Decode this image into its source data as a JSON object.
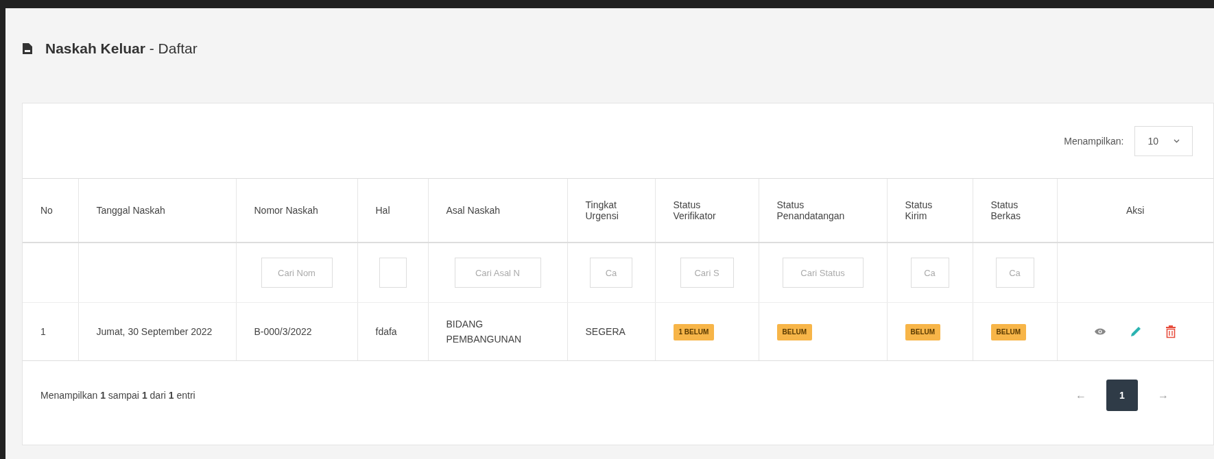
{
  "page": {
    "title_main": "Naskah Keluar",
    "title_sub": " - Daftar"
  },
  "length_menu": {
    "label": "Menampilkan:",
    "value": "10"
  },
  "table": {
    "columns": [
      "No",
      "Tanggal Naskah",
      "Nomor Naskah",
      "Hal",
      "Asal Naskah",
      "Tingkat Urgensi",
      "Status Verifikator",
      "Status Penandatangan",
      "Status Kirim",
      "Status Berkas",
      "Aksi"
    ],
    "filters": [
      {
        "kind": "none"
      },
      {
        "kind": "none"
      },
      {
        "kind": "text",
        "placeholder": "Cari Nom"
      },
      {
        "kind": "text"
      },
      {
        "kind": "text",
        "placeholder": "Cari Asal N"
      },
      {
        "kind": "text",
        "placeholder": "Ca"
      },
      {
        "kind": "text",
        "placeholder": "Cari S"
      },
      {
        "kind": "text",
        "placeholder": "Cari Status"
      },
      {
        "kind": "text",
        "placeholder": "Ca"
      },
      {
        "kind": "text",
        "placeholder": "Ca"
      },
      {
        "kind": "none"
      }
    ],
    "rows": [
      {
        "no": "1",
        "tanggal": "Jumat, 30 September 2022",
        "nomor": "B-000/3/2022",
        "hal": "fdafa",
        "asal": "BIDANG PEMBANGUNAN",
        "urgensi": "SEGERA",
        "verifikator": "1 BELUM",
        "penandatangan": "BELUM",
        "kirim": "BELUM",
        "berkas": "BELUM"
      }
    ]
  },
  "footer": {
    "info": "Menampilkan **1** sampai **1** dari **1** entri"
  },
  "pagination": [
    {
      "label": "←",
      "kind": "prev",
      "selected": false
    },
    {
      "label": "1",
      "kind": "page",
      "selected": true
    },
    {
      "label": "→",
      "kind": "next",
      "selected": false
    }
  ]
}
